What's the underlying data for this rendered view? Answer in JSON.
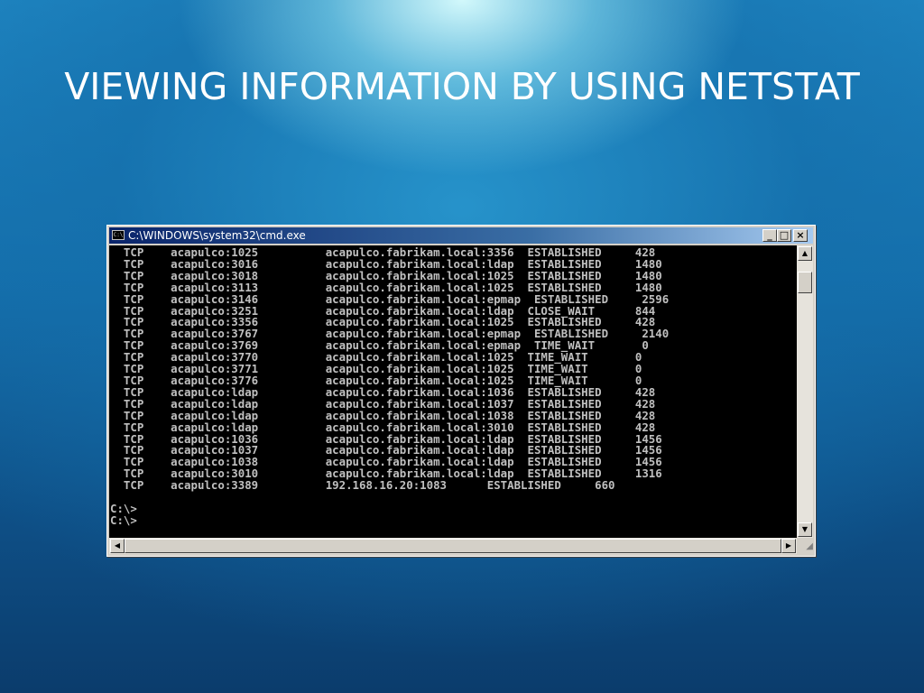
{
  "slide": {
    "title": "VIEWING INFORMATION BY USING NETSTAT"
  },
  "window": {
    "title": "C:\\WINDOWS\\system32\\cmd.exe",
    "icon_label": "C:\\",
    "controls": {
      "minimize": "_",
      "maximize": "□",
      "close": "×"
    }
  },
  "console": {
    "lines": [
      "  TCP    acapulco:1025          acapulco.fabrikam.local:3356  ESTABLISHED     428",
      "  TCP    acapulco:3016          acapulco.fabrikam.local:ldap  ESTABLISHED     1480",
      "  TCP    acapulco:3018          acapulco.fabrikam.local:1025  ESTABLISHED     1480",
      "  TCP    acapulco:3113          acapulco.fabrikam.local:1025  ESTABLISHED     1480",
      "  TCP    acapulco:3146          acapulco.fabrikam.local:epmap  ESTABLISHED     2596",
      "  TCP    acapulco:3251          acapulco.fabrikam.local:ldap  CLOSE_WAIT      844",
      "  TCP    acapulco:3356          acapulco.fabrikam.local:1025  ESTABLISHED     428",
      "  TCP    acapulco:3767          acapulco.fabrikam.local:epmap  ESTABLISHED     2140",
      "  TCP    acapulco:3769          acapulco.fabrikam.local:epmap  TIME_WAIT       0",
      "  TCP    acapulco:3770          acapulco.fabrikam.local:1025  TIME_WAIT       0",
      "  TCP    acapulco:3771          acapulco.fabrikam.local:1025  TIME_WAIT       0",
      "  TCP    acapulco:3776          acapulco.fabrikam.local:1025  TIME_WAIT       0",
      "  TCP    acapulco:ldap          acapulco.fabrikam.local:1036  ESTABLISHED     428",
      "  TCP    acapulco:ldap          acapulco.fabrikam.local:1037  ESTABLISHED     428",
      "  TCP    acapulco:ldap          acapulco.fabrikam.local:1038  ESTABLISHED     428",
      "  TCP    acapulco:ldap          acapulco.fabrikam.local:3010  ESTABLISHED     428",
      "  TCP    acapulco:1036          acapulco.fabrikam.local:ldap  ESTABLISHED     1456",
      "  TCP    acapulco:1037          acapulco.fabrikam.local:ldap  ESTABLISHED     1456",
      "  TCP    acapulco:1038          acapulco.fabrikam.local:ldap  ESTABLISHED     1456",
      "  TCP    acapulco:3010          acapulco.fabrikam.local:ldap  ESTABLISHED     1316",
      "  TCP    acapulco:3389          192.168.16.20:1083      ESTABLISHED     660",
      "",
      "C:\\>",
      "C:\\>"
    ]
  },
  "scrollbars": {
    "up_arrow": "▲",
    "down_arrow": "▼",
    "left_arrow": "◀",
    "right_arrow": "▶",
    "grip": "◢"
  }
}
